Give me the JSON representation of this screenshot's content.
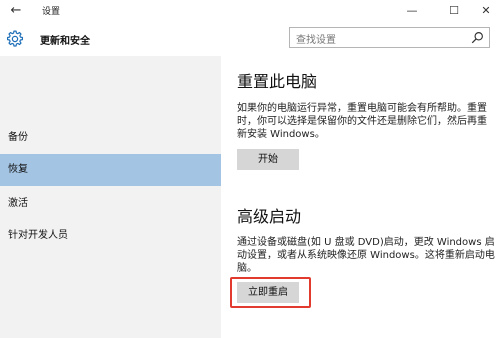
{
  "window": {
    "back_glyph": "←",
    "title": "设置",
    "minimize_glyph": "—",
    "maximize_glyph": "☐",
    "close_glyph": "✕"
  },
  "header": {
    "title": "更新和安全",
    "icon": "gear-icon"
  },
  "search": {
    "placeholder": "查找设置",
    "value": "",
    "icon": "search-icon"
  },
  "sidebar": {
    "items": [
      {
        "label": "备份",
        "selected": false
      },
      {
        "label": "恢复",
        "selected": true
      },
      {
        "label": "激活",
        "selected": false
      },
      {
        "label": "针对开发人员",
        "selected": false
      }
    ]
  },
  "reset": {
    "title": "重置此电脑",
    "description": "如果你的电脑运行异常，重置电脑可能会有所帮助。重置时，你可以选择是保留你的文件还是删除它们，然后再重新安装 Windows。",
    "button_label": "开始"
  },
  "advanced": {
    "title": "高级启动",
    "description": "通过设备或磁盘(如 U 盘或 DVD)启动，更改 Windows 启动设置，或者从系统映像还原 Windows。这将重新启动电脑。",
    "button_label": "立即重启"
  },
  "colors": {
    "sidebar_bg": "#f2f2f2",
    "selected_bg": "#a3c4e3",
    "button_bg": "#d6d6d6",
    "highlight": "#e23a2e"
  }
}
